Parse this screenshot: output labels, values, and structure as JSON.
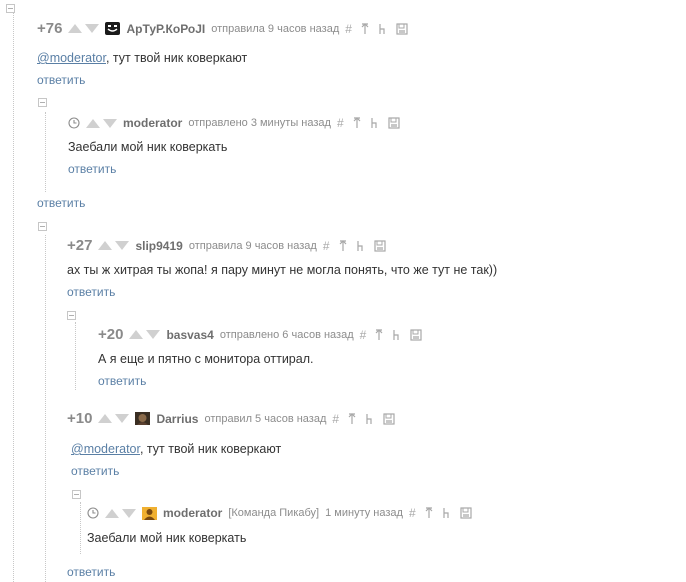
{
  "comments": [
    {
      "rating": "+76",
      "author": "АрТуР.КоРоЈI",
      "meta": "отправила 9 часов назад",
      "mention": "@moderator",
      "text": ", тут твой ник коверкают",
      "reply": "ответить"
    },
    {
      "author": "moderator",
      "meta": "отправлено 3 минуты назад",
      "text": "Заебали мой ник коверкать",
      "reply": "ответить"
    },
    {
      "reply": "ответить"
    },
    {
      "rating": "+27",
      "author": "slip9419",
      "meta": "отправила 9 часов назад",
      "text": "ах ты ж хитрая ты жопа! я пару минут не могла понять, что же тут не так))",
      "reply": "ответить"
    },
    {
      "rating": "+20",
      "author": "basvas4",
      "meta": "отправлено 6 часов назад",
      "text": "А я еще и пятно с монитора оттирал.",
      "reply": "ответить"
    },
    {
      "rating": "+10",
      "author": "Darrius",
      "meta": "отправил 5 часов назад",
      "mention": "@moderator",
      "text": ", тут твой ник коверкают",
      "reply": "ответить"
    },
    {
      "author": "moderator",
      "team": "[Команда Пикабу]",
      "meta": "1 минуту назад",
      "text": "Заебали мой ник коверкать"
    },
    {
      "reply": "ответить"
    }
  ],
  "colors": {
    "link": "#5a7fa5",
    "text": "#333333",
    "muted": "#8c8c8c"
  },
  "icons": [
    "hash-icon",
    "up-arrow-icon",
    "branch-icon",
    "save-icon",
    "clock-icon",
    "collapse-icon"
  ]
}
